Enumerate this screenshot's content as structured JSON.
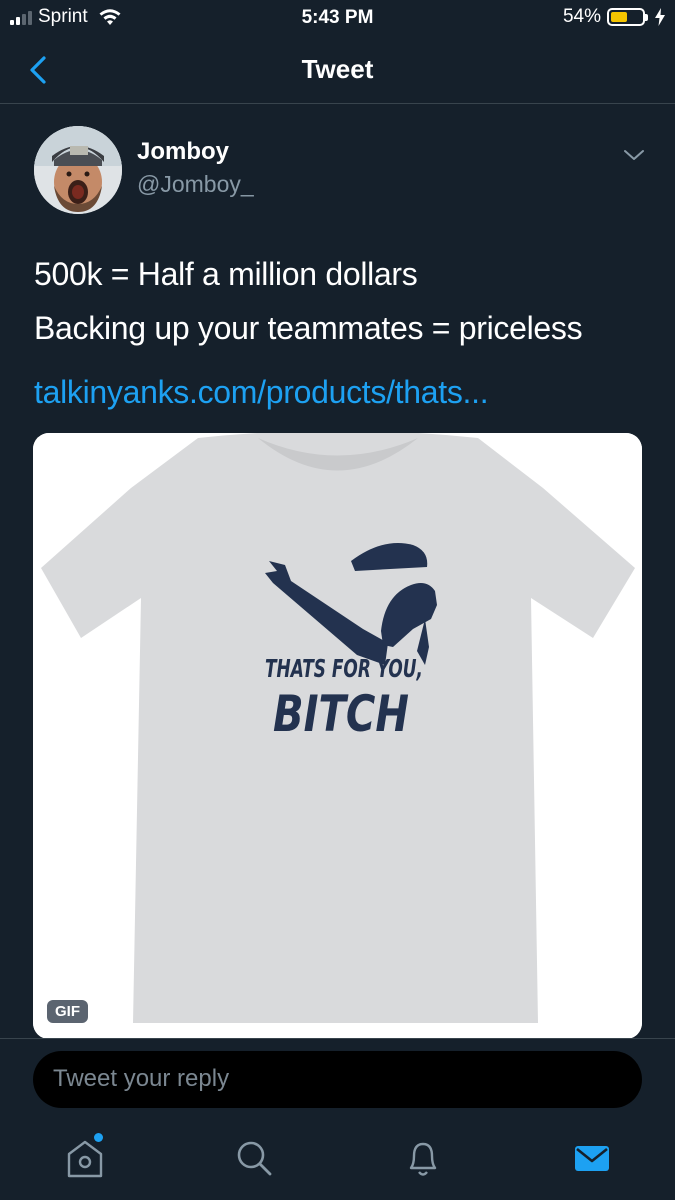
{
  "status_bar": {
    "carrier": "Sprint",
    "time": "5:43 PM",
    "battery_percent": "54%",
    "battery_level": 0.54,
    "signal_bars": 2,
    "signal_total": 4,
    "icons": [
      "signal-icon",
      "wifi-icon",
      "battery-icon",
      "charging-bolt-icon"
    ]
  },
  "nav": {
    "title": "Tweet",
    "back_icon": "chevron-left-icon"
  },
  "tweet": {
    "author_name": "Jomboy",
    "author_handle": "@Jomboy_",
    "caret_icon": "chevron-down-icon",
    "text_lines": [
      "500k = Half a million dollars",
      "Backing up your teammates = priceless"
    ],
    "link": "talkinyanks.com/products/thats...",
    "media": {
      "shirt_text_line1": "THATS FOR YOU,",
      "shirt_text_line2": "BITCH",
      "badge": "GIF"
    }
  },
  "reply": {
    "placeholder": "Tweet your reply"
  },
  "tab_bar": {
    "tabs": [
      "home-icon",
      "search-icon",
      "notifications-icon",
      "messages-icon"
    ],
    "accent": "#1da1f2"
  },
  "colors": {
    "background": "#15202b",
    "accent": "#1da1f2",
    "secondary_text": "#8899a6",
    "battery": "#f5c400"
  }
}
